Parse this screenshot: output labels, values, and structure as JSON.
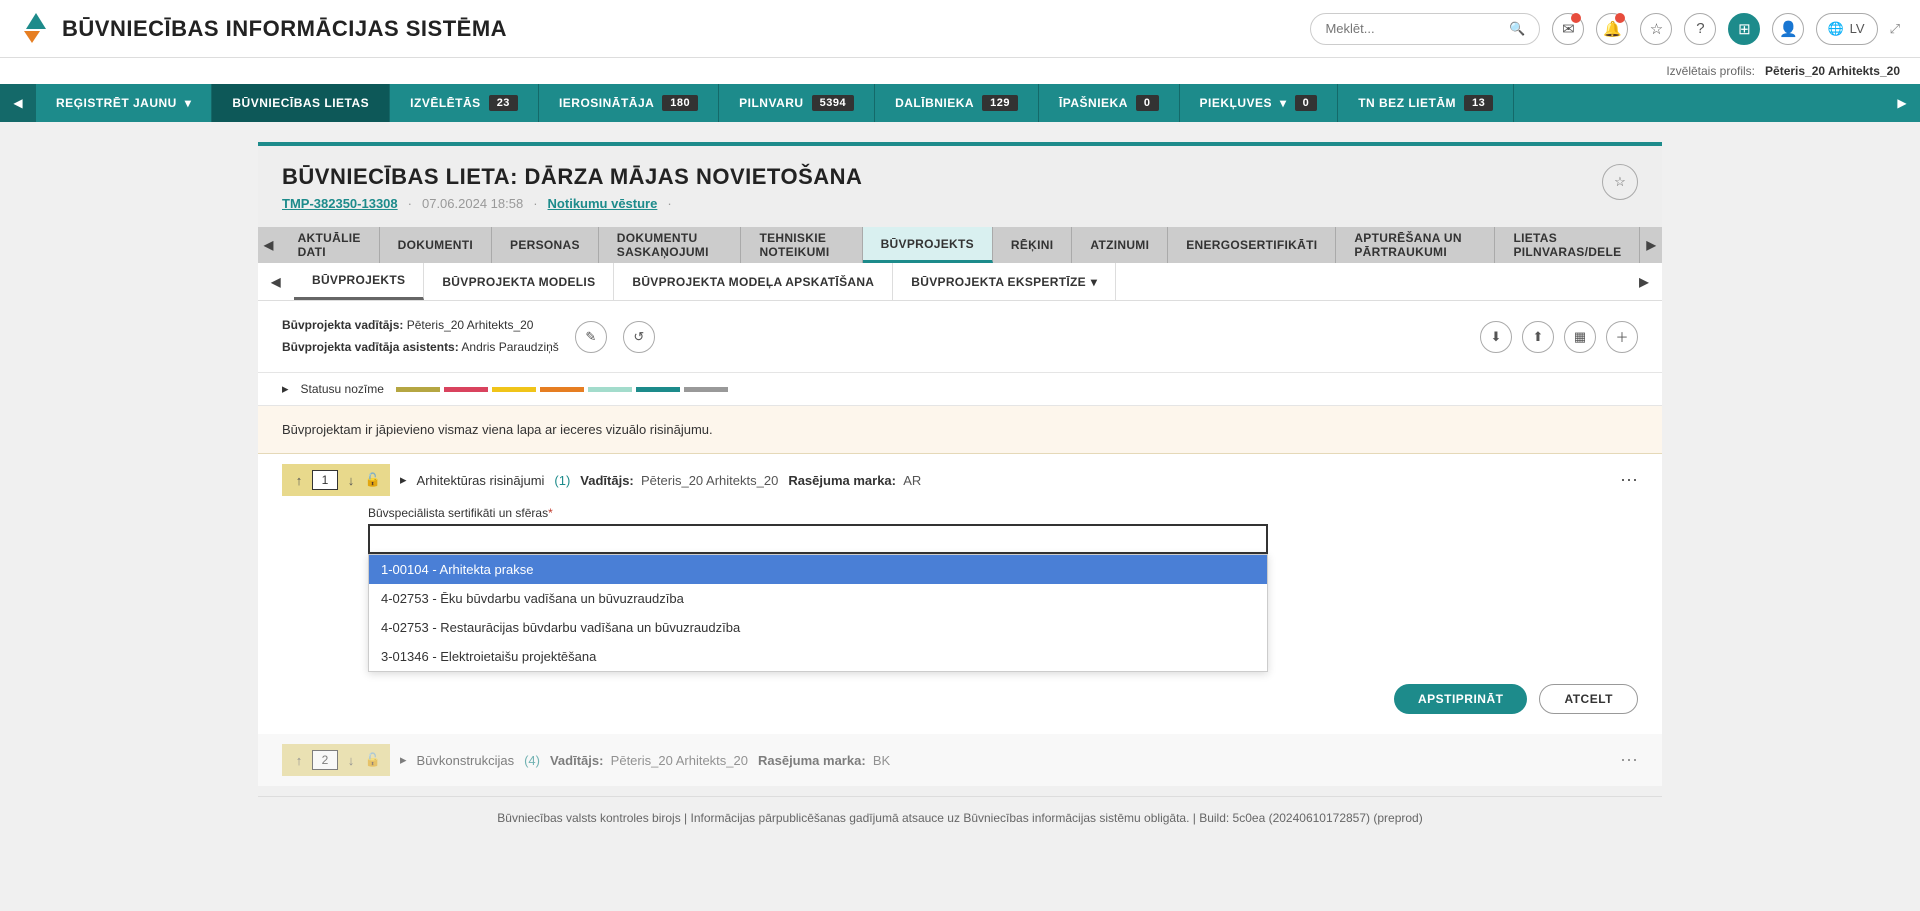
{
  "header": {
    "logo_text": "BŪVNIECĪBAS INFORMĀCIJAS SISTĒMA",
    "search_placeholder": "Meklēt...",
    "lang": "LV"
  },
  "profile": {
    "label": "Izvēlētais profils:",
    "name": "Pēteris_20 Arhitekts_20"
  },
  "nav": {
    "register": "REĢISTRĒT JAUNU",
    "cases": "BŪVNIECĪBAS LIETAS",
    "selected": "IZVĒLĒTĀS",
    "selected_n": "23",
    "initiator": "IEROSINĀTĀJA",
    "initiator_n": "180",
    "powers": "PILNVARU",
    "powers_n": "5394",
    "participant": "DALĪBNIEKA",
    "participant_n": "129",
    "owner": "ĪPAŠNIEKA",
    "owner_n": "0",
    "access": "PIEKĻUVES",
    "access_n": "0",
    "tn": "TN BEZ LIETĀM",
    "tn_n": "13"
  },
  "page": {
    "title": "BŪVNIECĪBAS LIETA: DĀRZA MĀJAS NOVIETOŠANA",
    "case_no": "TMP-382350-13308",
    "date": "07.06.2024 18:58",
    "history": "Notikumu vēsture"
  },
  "tabs": {
    "t1": "AKTUĀLIE DATI",
    "t2": "DOKUMENTI",
    "t3": "PERSONAS",
    "t4": "DOKUMENTU SASKAŅOJUMI",
    "t5": "TEHNISKIE NOTEIKUMI",
    "t6": "BŪVPROJEKTS",
    "t7": "RĒĶINI",
    "t8": "ATZINUMI",
    "t9": "ENERGOSERTIFIKĀTI",
    "t10": "APTURĒŠANA UN PĀRTRAUKUMI",
    "t11": "LIETAS PILNVARAS/DELE"
  },
  "subtabs": {
    "s1": "BŪVPROJEKTS",
    "s2": "BŪVPROJEKTA MODELIS",
    "s3": "BŪVPROJEKTA MODEĻA APSKATĪŠANA",
    "s4": "BŪVPROJEKTA EKSPERTĪZE"
  },
  "manager": {
    "lead_lbl": "Būvprojekta vadītājs:",
    "lead_val": "Pēteris_20 Arhitekts_20",
    "assist_lbl": "Būvprojekta vadītāja asistents:",
    "assist_val": "Andris Paraudziņš"
  },
  "status_label": "Statusu nozīme",
  "warning": "Būvprojektam ir jāpievieno vismaz viena lapa ar ieceres vizuālo risinājumu.",
  "section1": {
    "num": "1",
    "name": "Arhitektūras risinājumi",
    "count": "(1)",
    "lead_lbl": "Vadītājs:",
    "lead_val": "Pēteris_20 Arhitekts_20",
    "mark_lbl": "Rasējuma marka:",
    "mark_val": "AR"
  },
  "form": {
    "label": "Būvspeciālista sertifikāti un sfēras",
    "options": [
      "1-00104 - Arhitekta prakse",
      "4-02753 - Ēku būvdarbu vadīšana un būvuzraudzība",
      "4-02753 - Restaurācijas būvdarbu vadīšana un būvuzraudzība",
      "3-01346 - Elektroietaišu projektēšana"
    ]
  },
  "buttons": {
    "confirm": "APSTIPRINĀT",
    "cancel": "ATCELT"
  },
  "section2": {
    "num": "2",
    "name": "Būvkonstrukcijas",
    "count": "(4)",
    "lead_lbl": "Vadītājs:",
    "lead_val": "Pēteris_20 Arhitekts_20",
    "mark_lbl": "Rasējuma marka:",
    "mark_val": "BK"
  },
  "footer": "Būvniecības valsts kontroles birojs | Informācijas pārpublicēšanas gadījumā atsauce uz Būvniecības informācijas sistēmu obligāta. | Build: 5c0ea (20240610172857) (preprod)"
}
